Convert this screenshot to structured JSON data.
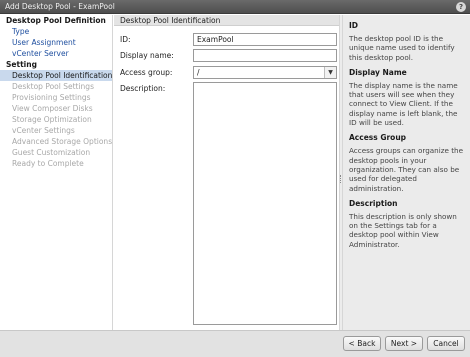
{
  "window": {
    "title": "Add Desktop Pool - ExamPool",
    "help_glyph": "?"
  },
  "nav": {
    "items": [
      {
        "label": "Desktop Pool Definition",
        "kind": "group"
      },
      {
        "label": "Type",
        "kind": "link"
      },
      {
        "label": "User Assignment",
        "kind": "link"
      },
      {
        "label": "vCenter Server",
        "kind": "link"
      },
      {
        "label": "Setting",
        "kind": "group"
      },
      {
        "label": "Desktop Pool Identification",
        "kind": "selected"
      },
      {
        "label": "Desktop Pool Settings",
        "kind": "disabled"
      },
      {
        "label": "Provisioning Settings",
        "kind": "disabled"
      },
      {
        "label": "View Composer Disks",
        "kind": "disabled"
      },
      {
        "label": "Storage Optimization",
        "kind": "disabled"
      },
      {
        "label": "vCenter Settings",
        "kind": "disabled"
      },
      {
        "label": "Advanced Storage Options",
        "kind": "disabled"
      },
      {
        "label": "Guest Customization",
        "kind": "disabled"
      },
      {
        "label": "Ready to Complete",
        "kind": "disabled"
      }
    ]
  },
  "form": {
    "section_title": "Desktop Pool Identification",
    "id_label": "ID:",
    "id_value": "ExamPool",
    "display_name_label": "Display name:",
    "display_name_value": "",
    "access_group_label": "Access group:",
    "access_group_value": "/",
    "description_label": "Description:",
    "description_value": ""
  },
  "help": {
    "sections": [
      {
        "title": "ID",
        "text": "The desktop pool ID is the unique name used to identify this desktop pool."
      },
      {
        "title": "Display Name",
        "text": "The display name is the name that users will see when they connect to View Client. If the display name is left blank, the ID will be used."
      },
      {
        "title": "Access Group",
        "text": "Access groups can organize the desktop pools in your organization. They can also be used for delegated administration."
      },
      {
        "title": "Description",
        "text": "This description is only shown on the Settings tab for a desktop pool within View Administrator."
      }
    ]
  },
  "footer": {
    "back_label": "< Back",
    "next_label": "Next >",
    "cancel_label": "Cancel"
  }
}
